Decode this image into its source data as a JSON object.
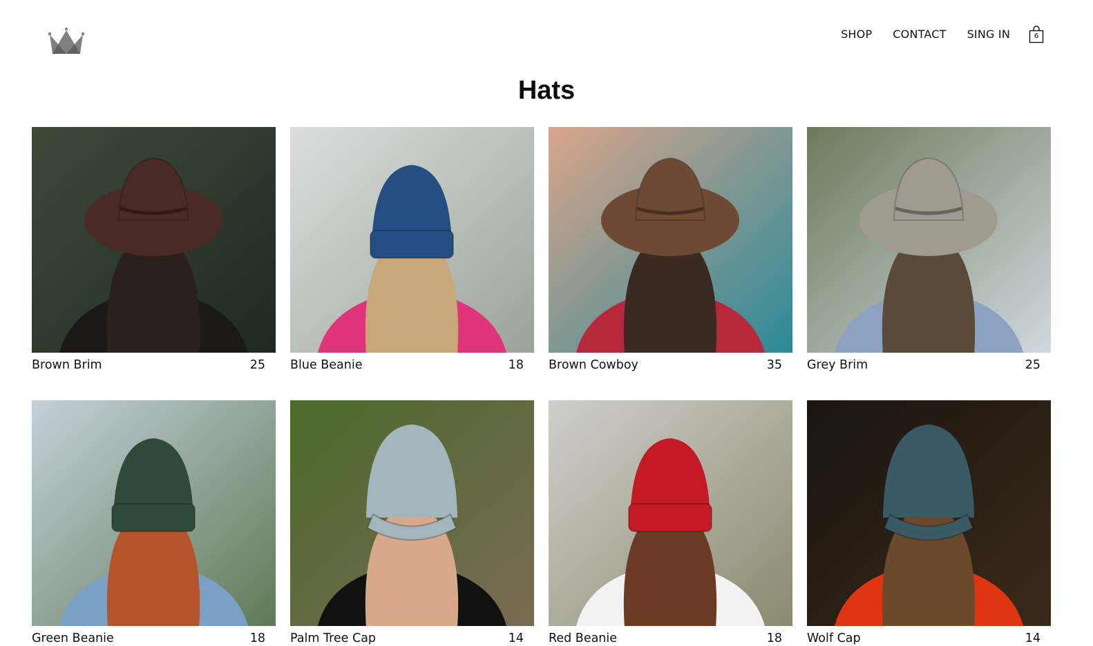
{
  "header": {
    "logo": "crown-icon",
    "nav": [
      {
        "label": "SHOP"
      },
      {
        "label": "CONTACT"
      },
      {
        "label": "SING IN"
      }
    ],
    "cart": {
      "icon": "shopping-bag-icon",
      "count": "6"
    }
  },
  "page": {
    "title": "Hats"
  },
  "products": [
    {
      "name": "Brown Brim",
      "price": "25",
      "bg": "#3d4a3a",
      "bg2": "#1e2a20",
      "hat": "#4a2a26",
      "hair": "#2a201c",
      "body": "#1c1a18",
      "hat_type": "fedora"
    },
    {
      "name": "Blue Beanie",
      "price": "18",
      "bg": "#dcdedd",
      "bg2": "#9aa39a",
      "hat": "#254e82",
      "hair": "#c8a77a",
      "body": "#e0357a",
      "hat_type": "beanie"
    },
    {
      "name": "Brown Cowboy",
      "price": "35",
      "bg": "#d9a58c",
      "bg2": "#2a8a99",
      "hat": "#6e4a35",
      "hair": "#3a2a22",
      "body": "#b8283c",
      "hat_type": "cowboy"
    },
    {
      "name": "Grey Brim",
      "price": "25",
      "bg": "#6c7a5a",
      "bg2": "#cfd8df",
      "hat": "#a09a91",
      "hair": "#5a4a3a",
      "body": "#8da2c0",
      "hat_type": "cowboy"
    },
    {
      "name": "Green Beanie",
      "price": "18",
      "bg": "#c5d0db",
      "bg2": "#5e7a55",
      "hat": "#2f4a38",
      "hair": "#b5532a",
      "body": "#7aa0c6",
      "hat_type": "beanie"
    },
    {
      "name": "Palm Tree Cap",
      "price": "14",
      "bg": "#4a6a2a",
      "bg2": "#7a6a55",
      "hat": "#a3b6bd",
      "hair": "#d8a88a",
      "body": "#111111",
      "hat_type": "cap"
    },
    {
      "name": "Red Beanie",
      "price": "18",
      "bg": "#cfcfcb",
      "bg2": "#8a8a70",
      "hat": "#c31a25",
      "hair": "#6a3a22",
      "body": "#f2f2f2",
      "hat_type": "beanie"
    },
    {
      "name": "Wolf Cap",
      "price": "14",
      "bg": "#1a1410",
      "bg2": "#3a2a1a",
      "hat": "#3a5a66",
      "hair": "#6a4a2a",
      "body": "#e03512",
      "hat_type": "cap"
    }
  ]
}
